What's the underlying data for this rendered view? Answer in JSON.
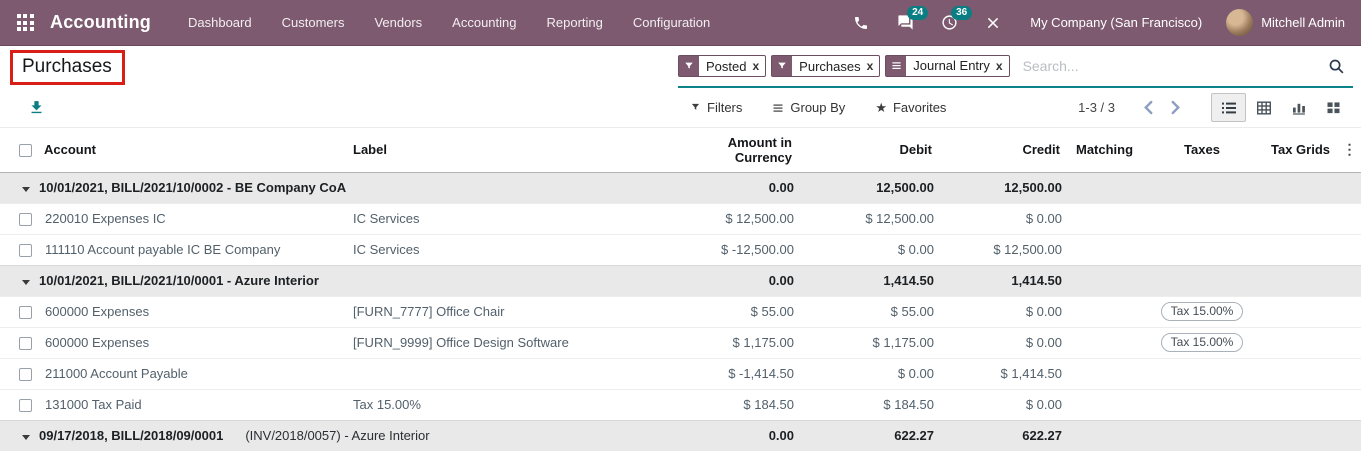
{
  "navbar": {
    "brand": "Accounting",
    "menu": [
      {
        "label": "Dashboard"
      },
      {
        "label": "Customers"
      },
      {
        "label": "Vendors"
      },
      {
        "label": "Accounting"
      },
      {
        "label": "Reporting"
      },
      {
        "label": "Configuration"
      }
    ],
    "messages_badge": "24",
    "activities_badge": "36",
    "company": "My Company (San Francisco)",
    "user": "Mitchell Admin"
  },
  "page": {
    "title": "Purchases"
  },
  "search": {
    "facets": [
      {
        "icon": "filter",
        "label": "Posted",
        "remove": "x"
      },
      {
        "icon": "filter",
        "label": "Purchases",
        "remove": "x"
      },
      {
        "icon": "group-by",
        "label": "Journal Entry",
        "remove": "x"
      }
    ],
    "placeholder": "Search..."
  },
  "controls": {
    "filters": "Filters",
    "group_by": "Group By",
    "favorites": "Favorites",
    "star_glyph": "★",
    "pager": "1-3 / 3",
    "header_menu_glyph": "⋮"
  },
  "table": {
    "columns": [
      "Account",
      "Label",
      "Amount in Currency",
      "Debit",
      "Credit",
      "Matching",
      "Taxes",
      "Tax Grids"
    ],
    "rows": [
      {
        "type": "group",
        "title": "10/01/2021, BILL/2021/10/0002 - BE Company CoA",
        "amount": "0.00",
        "debit": "12,500.00",
        "credit": "12,500.00"
      },
      {
        "type": "line",
        "account": "220010 Expenses IC",
        "label": "IC Services",
        "amount": "$ 12,500.00",
        "debit": "$ 12,500.00",
        "credit": "$ 0.00",
        "tax": ""
      },
      {
        "type": "line",
        "account": "111110 Account payable IC BE Company",
        "label": "IC Services",
        "amount": "$ -12,500.00",
        "debit": "$ 0.00",
        "credit": "$ 12,500.00",
        "tax": ""
      },
      {
        "type": "group",
        "title": "10/01/2021, BILL/2021/10/0001 - Azure Interior",
        "amount": "0.00",
        "debit": "1,414.50",
        "credit": "1,414.50"
      },
      {
        "type": "line",
        "account": "600000 Expenses",
        "label": "[FURN_7777] Office Chair",
        "amount": "$ 55.00",
        "debit": "$ 55.00",
        "credit": "$ 0.00",
        "tax": "Tax 15.00%"
      },
      {
        "type": "line",
        "account": "600000 Expenses",
        "label": "[FURN_9999] Office Design Software",
        "amount": "$ 1,175.00",
        "debit": "$ 1,175.00",
        "credit": "$ 0.00",
        "tax": "Tax 15.00%"
      },
      {
        "type": "line",
        "account": "211000 Account Payable",
        "label": "",
        "amount": "$ -1,414.50",
        "debit": "$ 0.00",
        "credit": "$ 1,414.50",
        "tax": ""
      },
      {
        "type": "line",
        "account": "131000 Tax Paid",
        "label": "Tax 15.00%",
        "amount": "$ 184.50",
        "debit": "$ 184.50",
        "credit": "$ 0.00",
        "tax": ""
      },
      {
        "type": "group",
        "title": "09/17/2018, BILL/2018/09/0001",
        "title_suffix": "(INV/2018/0057) - Azure Interior",
        "amount": "0.00",
        "debit": "622.27",
        "credit": "622.27"
      }
    ]
  },
  "colors": {
    "navbar_bg": "#7d5a6f",
    "accent_teal": "#0b7e84",
    "annotation_red": "#d91e18",
    "group_row_bg": "#e9e9e9"
  }
}
